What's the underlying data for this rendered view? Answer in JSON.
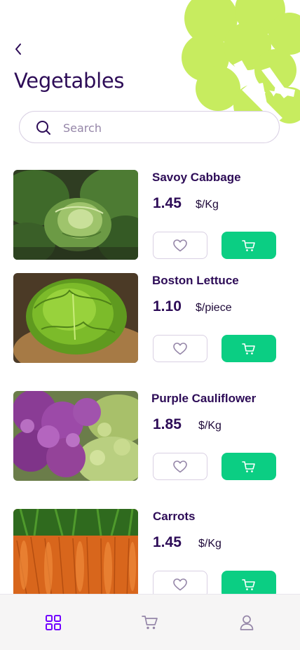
{
  "header": {
    "title": "Vegetables"
  },
  "search": {
    "placeholder": "Search",
    "value": ""
  },
  "products": [
    {
      "name": "Savoy Cabbage",
      "price": "1.45",
      "unit": "$/Kg"
    },
    {
      "name": "Boston Lettuce",
      "price": "1.10",
      "unit": "$/piece"
    },
    {
      "name": "Purple Cauliflower",
      "price": "1.85",
      "unit": "$/Kg"
    },
    {
      "name": "Carrots",
      "price": "1.45",
      "unit": "$/Kg"
    }
  ],
  "bottom_nav": {
    "items": [
      {
        "icon": "grid-icon",
        "active": true
      },
      {
        "icon": "cart-icon",
        "active": false
      },
      {
        "icon": "user-icon",
        "active": false
      }
    ]
  },
  "colors": {
    "primary_text": "#2d0c57",
    "muted_text": "#9586a8",
    "accent_green": "#0bce83",
    "nav_active": "#7203ff",
    "nav_inactive": "#9586a8",
    "decoration": "#c7ec5f"
  }
}
